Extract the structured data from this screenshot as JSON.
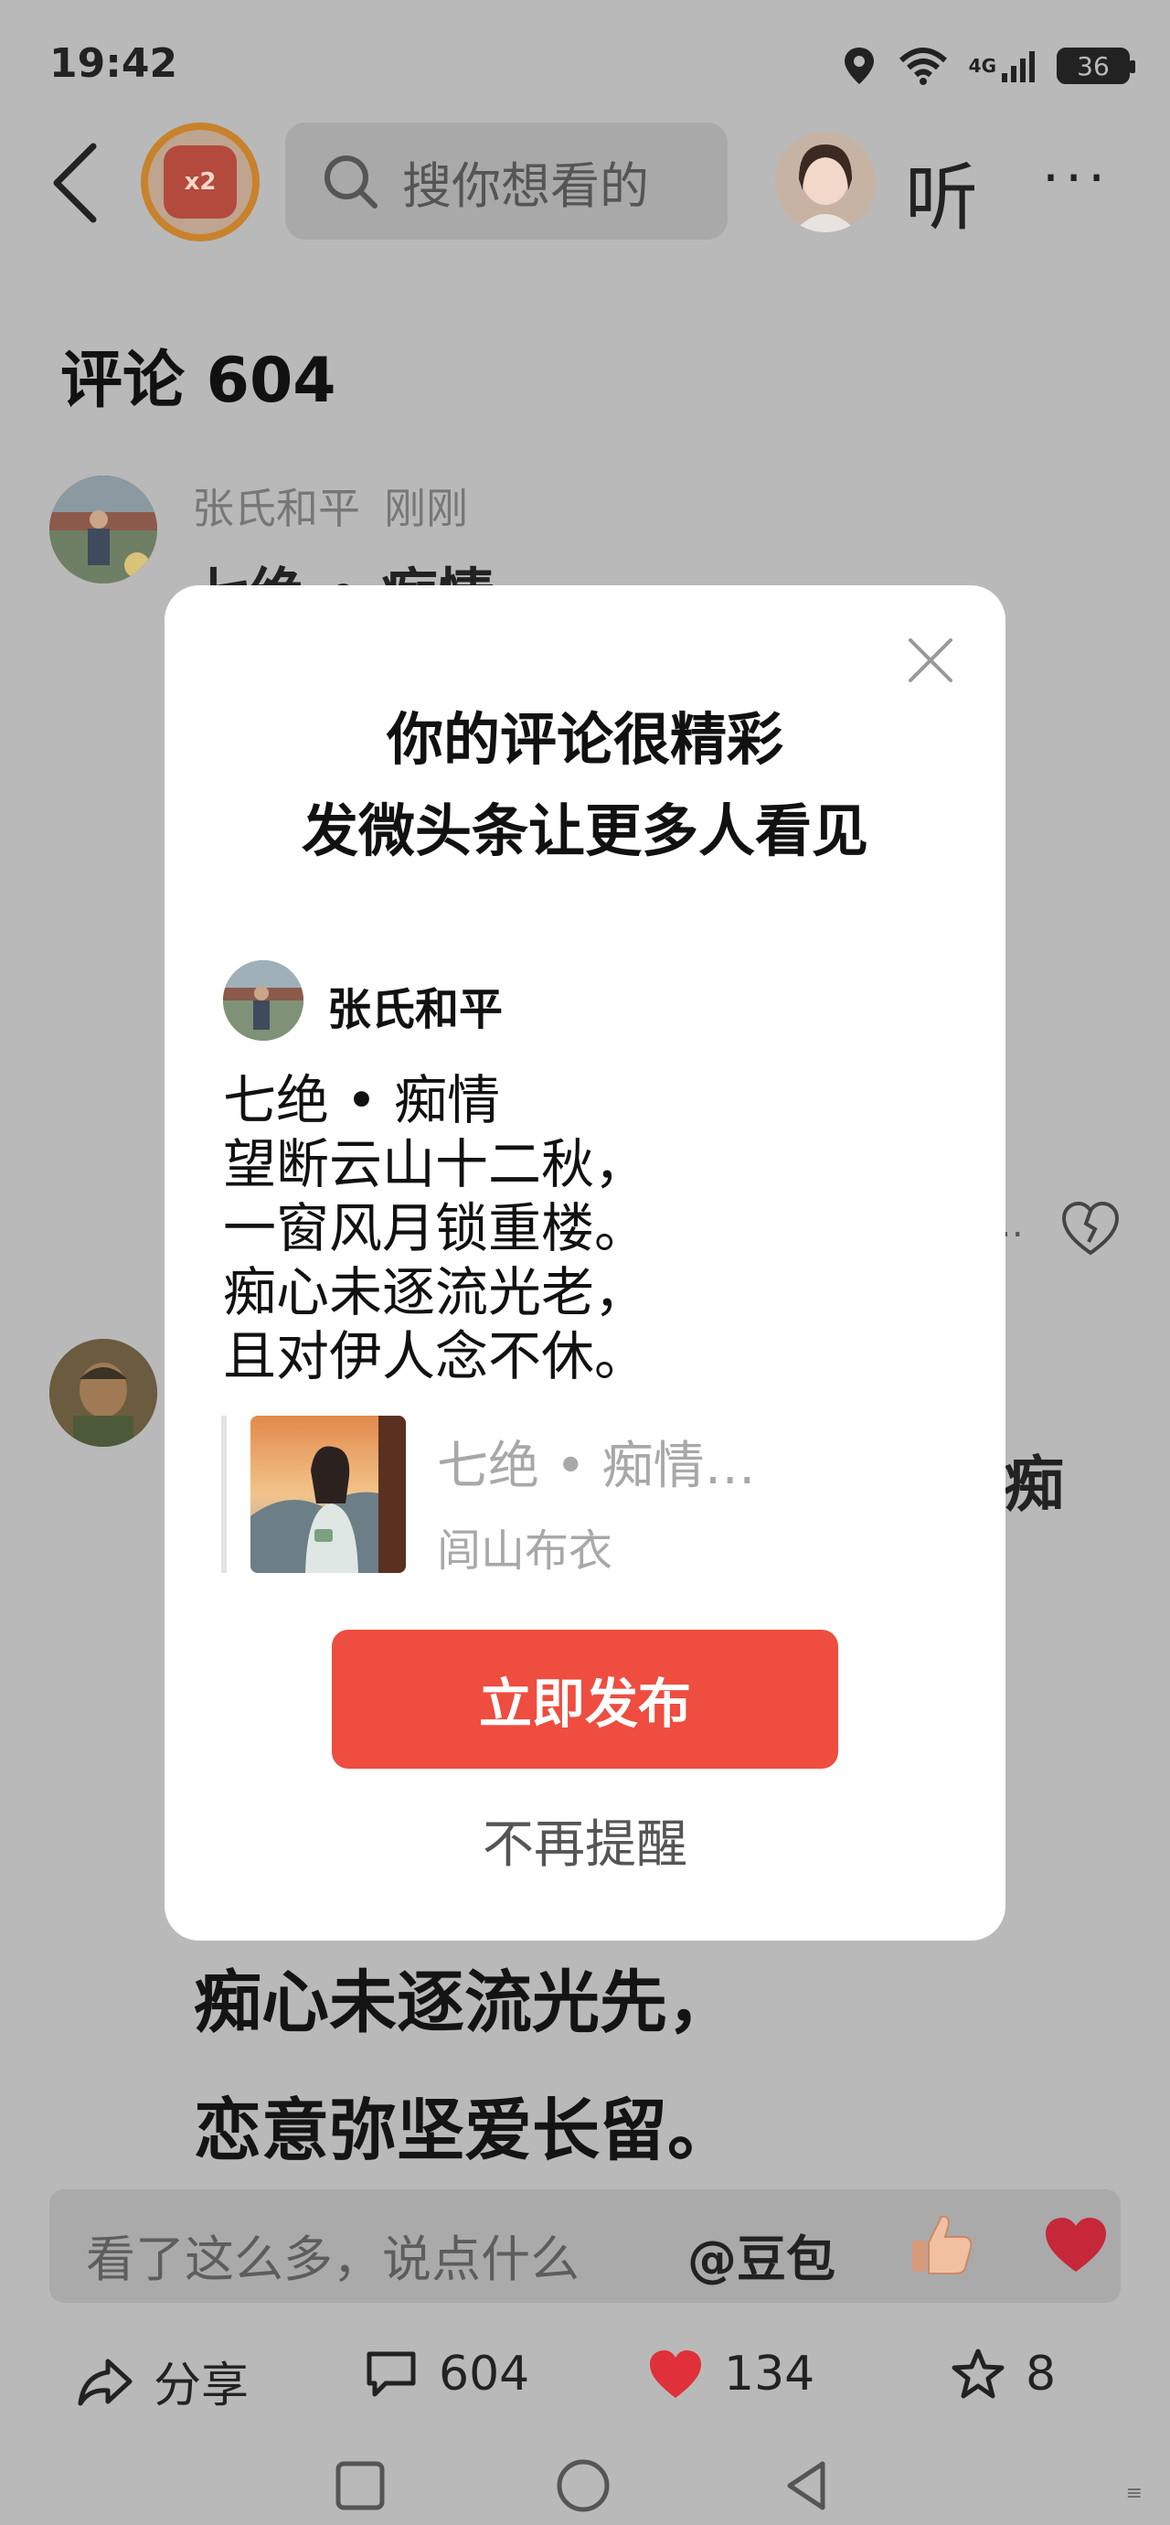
{
  "status_bar": {
    "time": "19:42",
    "network": "4G",
    "battery": "36"
  },
  "top_nav": {
    "redpacket_badge": "x2",
    "search_placeholder": "搜你想看的",
    "listen_label": "听",
    "more_label": "···"
  },
  "comments": {
    "title": "评论 604",
    "first": {
      "author": "张氏和平",
      "time": "刚刚",
      "partial_text": "七绝 • 痴情"
    },
    "second_fragment": "痴",
    "bg_lines": [
      "痴心未逐流光先，",
      "恋意弥坚爱长留。"
    ]
  },
  "modal": {
    "title_line1": "你的评论很精彩",
    "title_line2": "发微头条让更多人看见",
    "post": {
      "author": "张氏和平",
      "lines": [
        "七绝 • 痴情",
        "望断云山十二秋，",
        "一窗风月锁重楼。",
        "痴心未逐流光老，",
        "且对伊人念不休。"
      ]
    },
    "quote": {
      "title": "七绝 • 痴情…",
      "author": "闾山布衣"
    },
    "publish_label": "立即发布",
    "dont_remind_label": "不再提醒"
  },
  "comment_bar": {
    "placeholder": "看了这么多，说点什么",
    "mention": "@豆包"
  },
  "actions": {
    "share_label": "分享",
    "comment_count": "604",
    "like_count": "134",
    "fav_count": "8"
  },
  "colors": {
    "accent_red": "#ee4d40",
    "dim_overlay_bg": "#b9b9b9",
    "heart_red": "#e0303a"
  }
}
